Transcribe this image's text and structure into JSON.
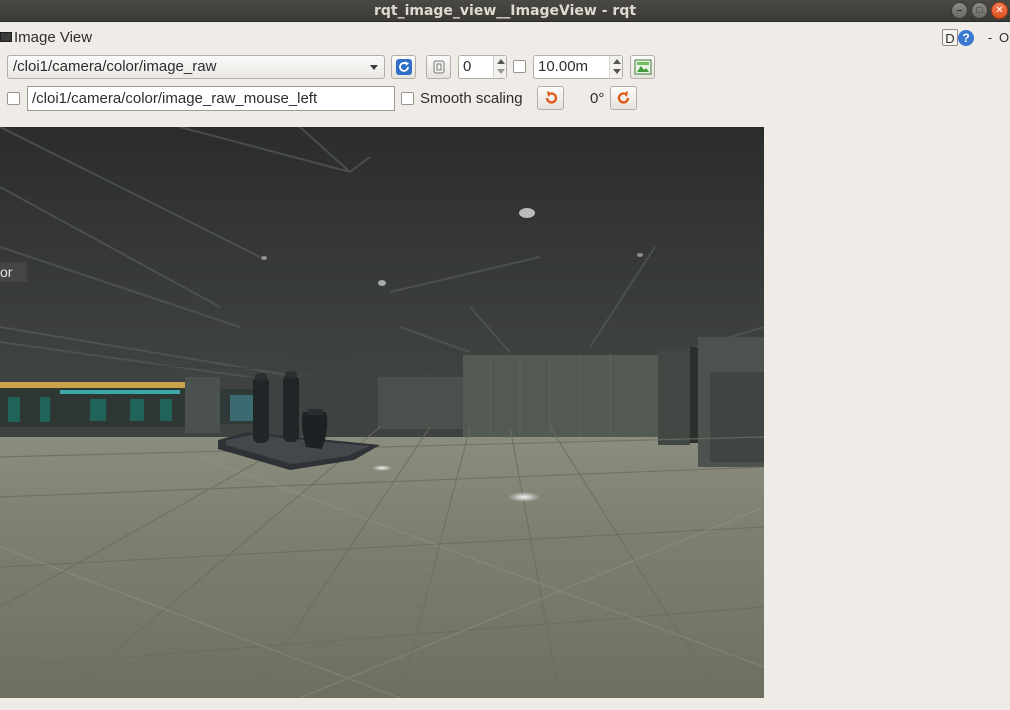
{
  "window": {
    "title": "rqt_image_view__ImageView - rqt"
  },
  "plugin": {
    "title": "Image View",
    "help_button": "?",
    "detach_button": "D",
    "minimize_label": "-",
    "close_label": "O"
  },
  "toolbar": {
    "topic": "/cloi1/camera/color/image_raw",
    "frame_value": "0",
    "max_range_value": "10.00m",
    "mouse_topic": "/cloi1/camera/color/image_raw_mouse_left",
    "smooth_scaling_label": "Smooth scaling",
    "rotation_label": "0°"
  },
  "image": {
    "overlay_text": "or"
  },
  "icons": {
    "refresh": "refresh-icon",
    "zoom": "zoom-icon",
    "save": "save-image-icon",
    "rotate_left": "rotate-left-icon",
    "rotate_right": "rotate-right-icon"
  },
  "colors": {
    "refresh_blue": "#2f6fc5",
    "rotate_orange": "#e05a1c",
    "save_green": "#3f9b3a"
  }
}
